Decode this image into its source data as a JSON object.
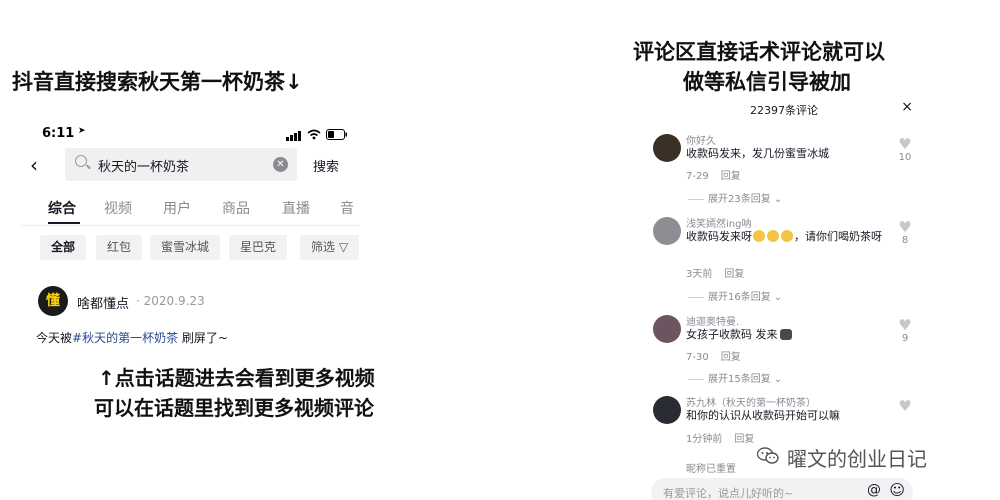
{
  "left_caption": "抖音直接搜索秋天第一杯奶茶↓",
  "right_caption": [
    "评论区直接话术评论就可以",
    "做等私信引导被加"
  ],
  "phone": {
    "status": {
      "time": "6:11"
    },
    "search": {
      "query": "秋天的一杯奶茶",
      "button": "搜索"
    },
    "tabs": [
      "综合",
      "视频",
      "用户",
      "商品",
      "直播",
      "音"
    ],
    "chips": [
      "全部",
      "红包",
      "蜜雪冰城",
      "星巴克",
      "筛选"
    ],
    "post": {
      "avatar_text": "懂",
      "username": "啥都懂点",
      "date": "· 2020.9.23",
      "text_before": "今天被",
      "hashtag": "#秋天的第一杯奶茶",
      "text_after": " 刷屏了~"
    }
  },
  "annotation": [
    "↑点击话题进去会看到更多视频",
    "可以在话题里找到更多视频评论"
  ],
  "comments_panel": {
    "header": "22397条评论",
    "close": "×",
    "comments": [
      {
        "name": "你好久",
        "text": "收款码发来，发几份蜜雪冰城",
        "time": "7-29",
        "reply": "回复",
        "likes": "10",
        "expand": "展开23条回复"
      },
      {
        "name": "浅笑嫣然ing呐",
        "text_a": "收款码发来呀",
        "text_b": "，请你们喝奶茶呀",
        "time": "3天前",
        "reply": "回复",
        "likes": "8",
        "expand": "展开16条回复"
      },
      {
        "name": "迪迦奥特曼.",
        "text": "女孩子收款码 发来",
        "time": "7-30",
        "reply": "回复",
        "likes": "9",
        "expand": "展开15条回复"
      },
      {
        "name": "苏九林（秋天的第一杯奶茶）",
        "text": "和你的认识从收款码开始可以嘛",
        "time": "1分钟前",
        "reply": "回复",
        "likes": ""
      }
    ],
    "last_name": "昵称已重置",
    "input_placeholder": "有爱评论，说点儿好听的~",
    "at_icon": "@",
    "emoji_icon": "☺"
  },
  "watermark": "曜文的创业日记",
  "colors": {
    "hashtag": "#2a4a8d",
    "muted": "#8a8b91",
    "chip_bg": "#f2f2f4"
  },
  "icons": [
    "back-arrow-icon",
    "search-icon",
    "clear-icon",
    "filter-icon",
    "heart-icon",
    "close-icon",
    "at-icon",
    "emoji-icon",
    "wechat-icon"
  ]
}
